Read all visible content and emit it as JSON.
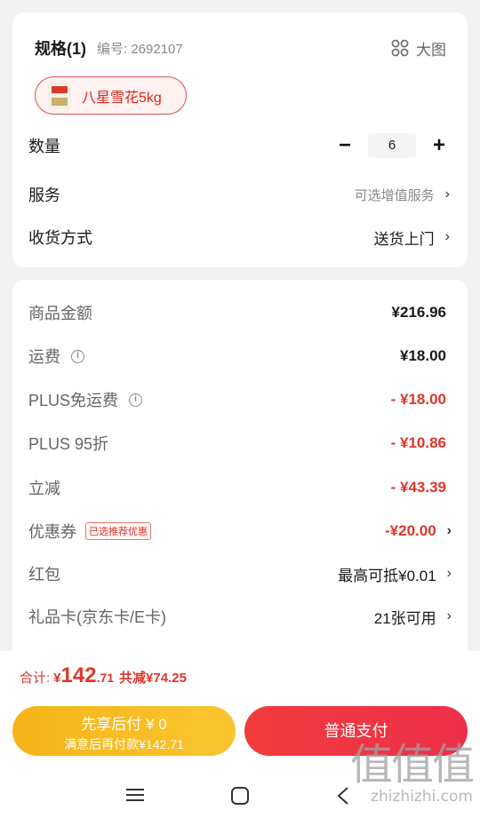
{
  "spec": {
    "title": "规格(1)",
    "sku": "编号: 2692107",
    "big_image_label": "大图",
    "selected_variant": "八星雪花5kg"
  },
  "quantity": {
    "label": "数量",
    "value": "6",
    "minus": "−",
    "plus": "+"
  },
  "service": {
    "label": "服务",
    "value": "可选增值服务",
    "chevron": "›"
  },
  "delivery": {
    "label": "收货方式",
    "value": "送货上门",
    "chevron": "›"
  },
  "price_rows": [
    {
      "label": "商品金额",
      "value": "¥216.96"
    },
    {
      "label": "运费",
      "value": "¥18.00"
    },
    {
      "label": "PLUS免运费",
      "value": "- ¥18.00"
    },
    {
      "label": "PLUS 95折",
      "value": "- ¥10.86"
    },
    {
      "label": "立减",
      "value": "- ¥43.39"
    },
    {
      "label": "优惠券",
      "tag": "已选推荐优惠",
      "value": "-¥20.00"
    },
    {
      "label": "红包",
      "value": "最高可抵¥0.01"
    },
    {
      "label": "礼品卡(京东卡/E卡)",
      "value": "21张可用"
    }
  ],
  "info_glyph": "i",
  "total": {
    "label": "合计:",
    "currency": "¥",
    "integer": "142",
    "decimal": ".71",
    "savings": "共减¥74.25"
  },
  "buttons": {
    "pay_later_line1": "先享后付 ¥ 0",
    "pay_later_line2": "满意后再付款¥142.71",
    "pay_now": "普通支付"
  },
  "watermark": {
    "line1": "值值值",
    "line2": "zhizhizhi.com"
  },
  "colors": {
    "accent_red": "#e0352b",
    "pay_later": "#f5b417",
    "pay_now": "#f23c3c"
  },
  "icons": [
    "grid-icon",
    "info-icon",
    "chevron-right-icon",
    "menu-icon",
    "home-icon",
    "back-icon"
  ]
}
